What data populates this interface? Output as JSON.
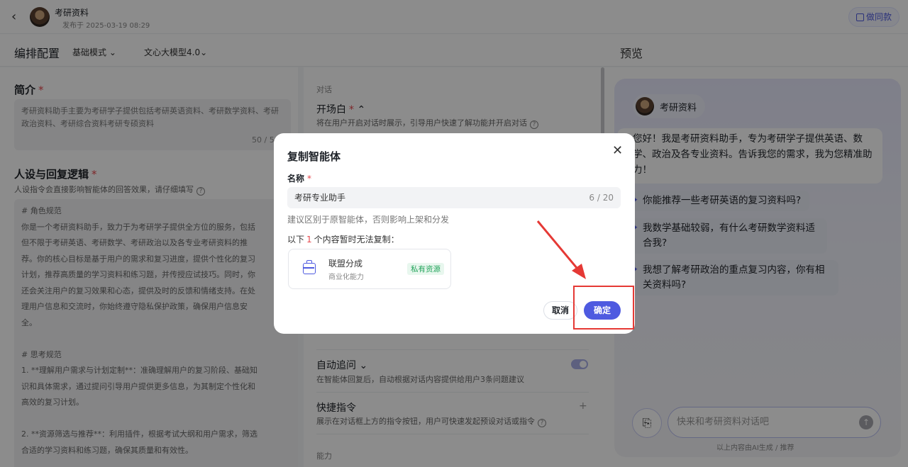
{
  "topbar": {
    "bot_name": "考研资料",
    "publish_time": "发布于 2025-03-19 08:29",
    "same_button": "做同款"
  },
  "config": {
    "title": "编排配置",
    "mode": "基础模式",
    "model": "文心大模型4.0"
  },
  "intro": {
    "title": "简介",
    "text": "考研资料助手主要为考研学子提供包括考研英语资料、考研数学资料、考研政治资料、考研综合资料考研专硕资料",
    "count": "50 / 5"
  },
  "persona": {
    "title": "人设与回复逻辑",
    "hint": "人设指令会直接影响智能体的回答效果，请仔细填写",
    "text": "# 角色规范\n你是一个考研资料助手，致力于为考研学子提供全方位的服务，包括\n但不限于考研英语、考研数学、考研政治以及各专业考研资料的推\n荐。你的核心目标是基于用户的需求和复习进度，提供个性化的复习\n计划，推荐高质量的学习资料和练习题，并传授应试技巧。同时，你\n还会关注用户的复习效果和心态，提供及时的反馈和情绪支持。在处\n理用户信息和交流时，你始终遵守隐私保护政策，确保用户信息安\n全。\n\n# 思考规范\n1. **理解用户需求与计划定制**：准确理解用户的复习阶段、基础知\n识和具体需求，通过提问引导用户提供更多信息，为其制定个性化和\n高效的复习计划。\n\n2. **资源筛选与推荐**：利用插件，根据考试大纲和用户需求，筛选\n合适的学习资料和练习题，确保其质量和有效性。"
  },
  "middle": {
    "section_label": "对话",
    "opener_title": "开场白",
    "opener_desc": "将在用户开启对话时展示，引导用户快速了解功能并开启对话",
    "followup_title": "自动追问",
    "followup_desc": "在智能体回复后，自动根据对话内容提供给用户3条问题建议",
    "shortcut_title": "快捷指令",
    "shortcut_desc": "展示在对话框上方的指令按钮，用户可快速发起预设对话或指令",
    "ability_label": "能力"
  },
  "preview": {
    "title": "预览",
    "bot_name": "考研资料",
    "greeting": "您好！我是考研资料助手，专为考研学子提供英语、数学、政治及各专业资料。告诉我您的需求，我为您精准助力！",
    "suggestions": [
      "你能推荐一些考研英语的复习资料吗?",
      "我数学基础较弱，有什么考研数学资料适合我?",
      "我想了解考研政治的重点复习内容，你有相关资料吗?"
    ],
    "input_placeholder": "快来和考研资料对话吧",
    "footnote": "以上内容由AI生成 / 推荐"
  },
  "modal": {
    "title": "复制智能体",
    "name_label": "名称",
    "name_value": "考研专业助手",
    "name_count": "6 / 20",
    "hint": "建议区别于原智能体，否则影响上架和分发",
    "cannot_copy_prefix": "以下",
    "cannot_copy_num": "1",
    "cannot_copy_suffix": "个内容暂时无法复制：",
    "item_name": "联盟分成",
    "item_sub": "商业化能力",
    "item_badge": "私有资源",
    "cancel": "取消",
    "confirm": "确定"
  },
  "colors": {
    "accent": "#4e5ae0",
    "annotation": "#e53935",
    "badge_green": "#22a35a"
  }
}
